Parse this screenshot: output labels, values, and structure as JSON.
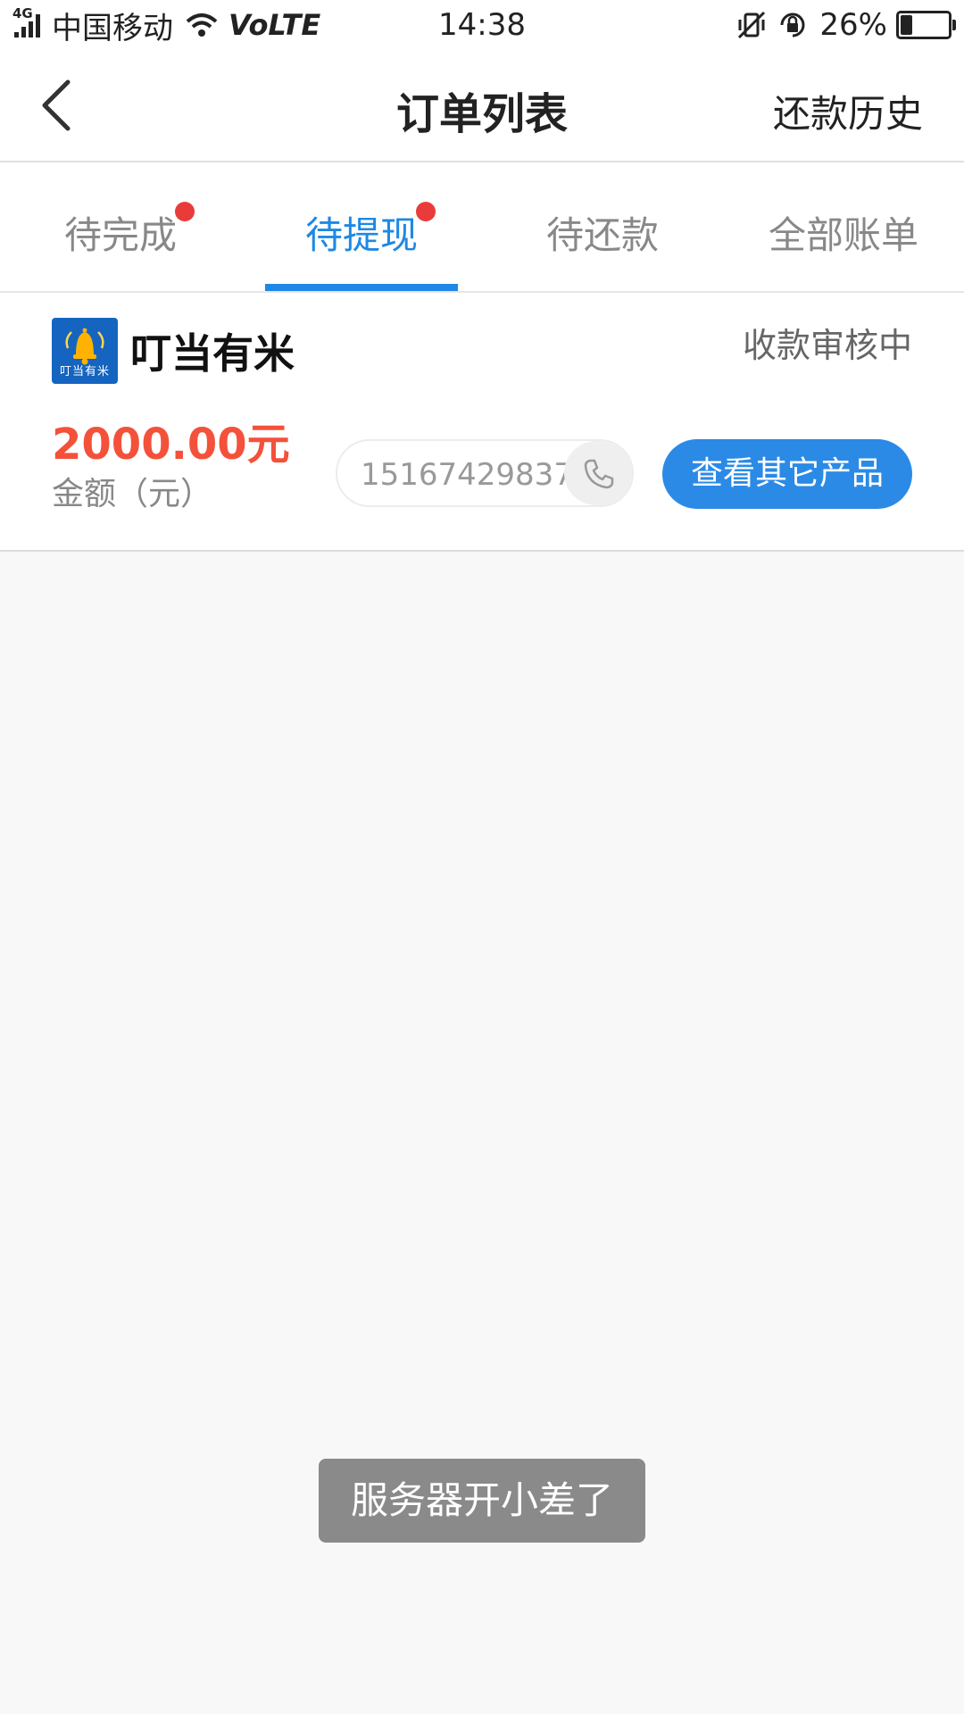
{
  "status_bar": {
    "network_type": "4G",
    "carrier": "中国移动",
    "volte": "VoLTE",
    "time": "14:38",
    "battery_percent": "26%",
    "battery_level": 0.26
  },
  "nav": {
    "title": "订单列表",
    "right_link": "还款历史"
  },
  "tabs": [
    {
      "label": "待完成",
      "badge": true,
      "active": false
    },
    {
      "label": "待提现",
      "badge": true,
      "active": true
    },
    {
      "label": "待还款",
      "badge": false,
      "active": false
    },
    {
      "label": "全部账单",
      "badge": false,
      "active": false
    }
  ],
  "order": {
    "logo_text": "叮当有米",
    "product_name": "叮当有米",
    "status": "收款审核中",
    "amount": "2000.00元",
    "amount_label": "金额（元）",
    "phone": "15167429837",
    "action_button": "查看其它产品"
  },
  "toast": {
    "message": "服务器开小差了"
  },
  "colors": {
    "accent": "#1e88e5",
    "button": "#2b8ae6",
    "amount": "#f4513a",
    "badge": "#ea3b3b",
    "toast_bg": "#8a8a8a"
  }
}
